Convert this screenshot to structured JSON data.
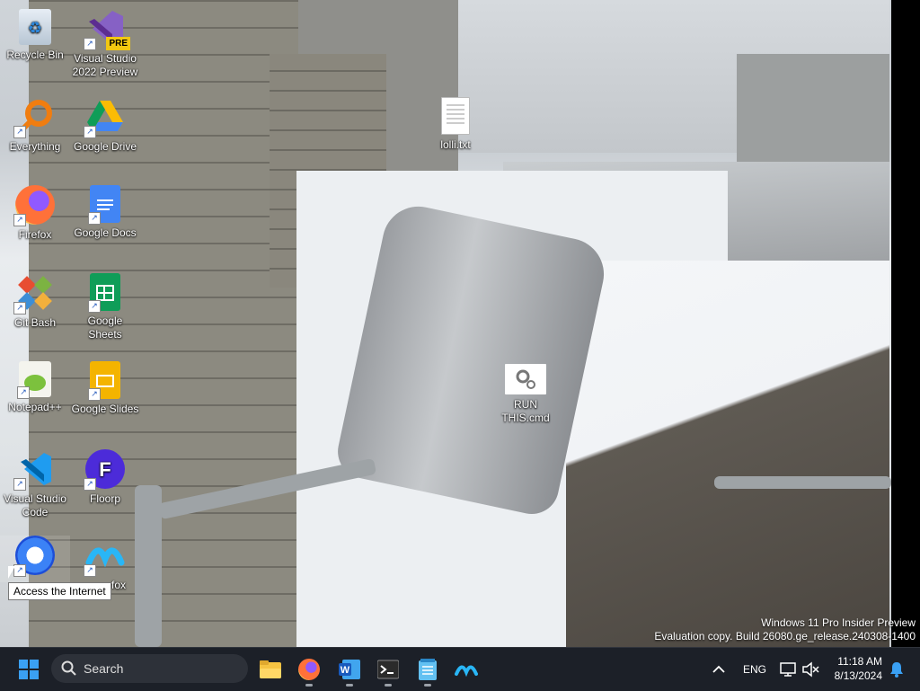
{
  "desktop": {
    "icons": [
      {
        "label": "Recycle Bin"
      },
      {
        "label": "Visual Studio 2022 Preview",
        "badge": "PRE"
      },
      {
        "label": "Everything"
      },
      {
        "label": "Google Drive"
      },
      {
        "label": "Firefox"
      },
      {
        "label": "Google Docs"
      },
      {
        "label": "Git Bash"
      },
      {
        "label": "Google Sheets"
      },
      {
        "label": "Notepad++"
      },
      {
        "label": "Google Slides"
      },
      {
        "label": "Visual Studio Code"
      },
      {
        "label": "Floorp"
      },
      {
        "label": "Access the Internet"
      },
      {
        "label": "fox"
      },
      {
        "label": "lolli.txt"
      },
      {
        "label": "RUN THIS.cmd"
      }
    ],
    "tooltip": "Access the Internet",
    "watermark": {
      "line1": "Windows 11 Pro Insider Preview",
      "line2": "Evaluation copy. Build 26080.ge_release.240308-1400"
    }
  },
  "taskbar": {
    "search_label": "Search",
    "pinned": [
      "start-icon",
      "file-explorer-icon",
      "firefox-icon",
      "word-icon",
      "terminal-icon",
      "notepad-icon",
      "waterfox-icon"
    ],
    "tray": {
      "language": "ENG",
      "time": "11:18 AM",
      "date": "8/13/2024"
    }
  },
  "colors": {
    "taskbar_bg": "#1c2028",
    "accent": "#0078d4"
  }
}
